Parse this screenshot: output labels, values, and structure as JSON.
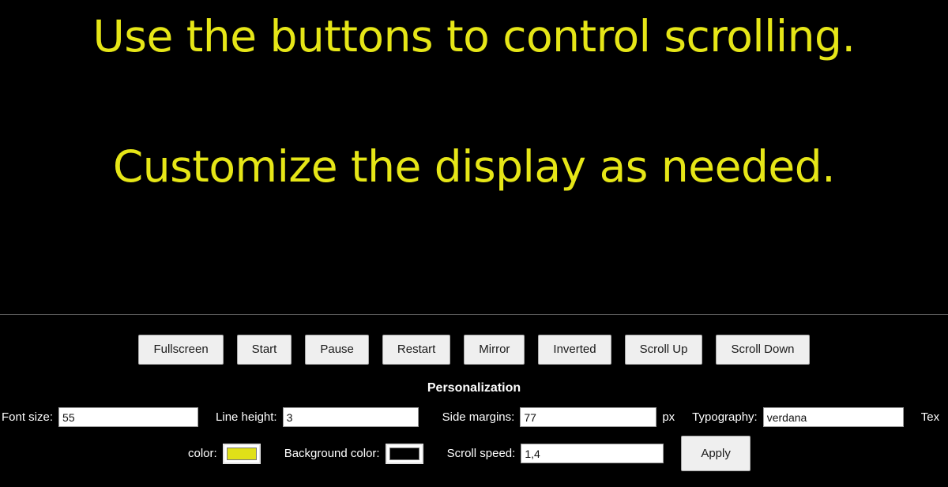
{
  "prompter": {
    "lines": [
      "Use the buttons to control scrolling.",
      "Customize the display as needed."
    ],
    "text_color": "#e6e617",
    "background_color": "#000000"
  },
  "toolbar": {
    "buttons": [
      {
        "label": "Fullscreen",
        "name": "fullscreen-button"
      },
      {
        "label": "Start",
        "name": "start-button"
      },
      {
        "label": "Pause",
        "name": "pause-button"
      },
      {
        "label": "Restart",
        "name": "restart-button"
      },
      {
        "label": "Mirror",
        "name": "mirror-button"
      },
      {
        "label": "Inverted",
        "name": "inverted-button"
      },
      {
        "label": "Scroll Up",
        "name": "scroll-up-button"
      },
      {
        "label": "Scroll Down",
        "name": "scroll-down-button"
      }
    ]
  },
  "personalization": {
    "title": "Personalization",
    "font_size": {
      "label": "Font size:",
      "value": "55"
    },
    "line_height": {
      "label": "Line height:",
      "value": "3"
    },
    "side_margins": {
      "label": "Side margins:",
      "value": "77",
      "unit": "px"
    },
    "typography": {
      "label": "Typography:",
      "value": "verdana"
    },
    "text_color": {
      "label_full": "Text color:",
      "label_visible_start": "Tex",
      "label_wrapped": "color:",
      "value": "#e0e018"
    },
    "background_color": {
      "label": "Background color:",
      "value": "#000000"
    },
    "scroll_speed": {
      "label": "Scroll speed:",
      "value": "1,4"
    },
    "apply": {
      "label": "Apply"
    }
  }
}
